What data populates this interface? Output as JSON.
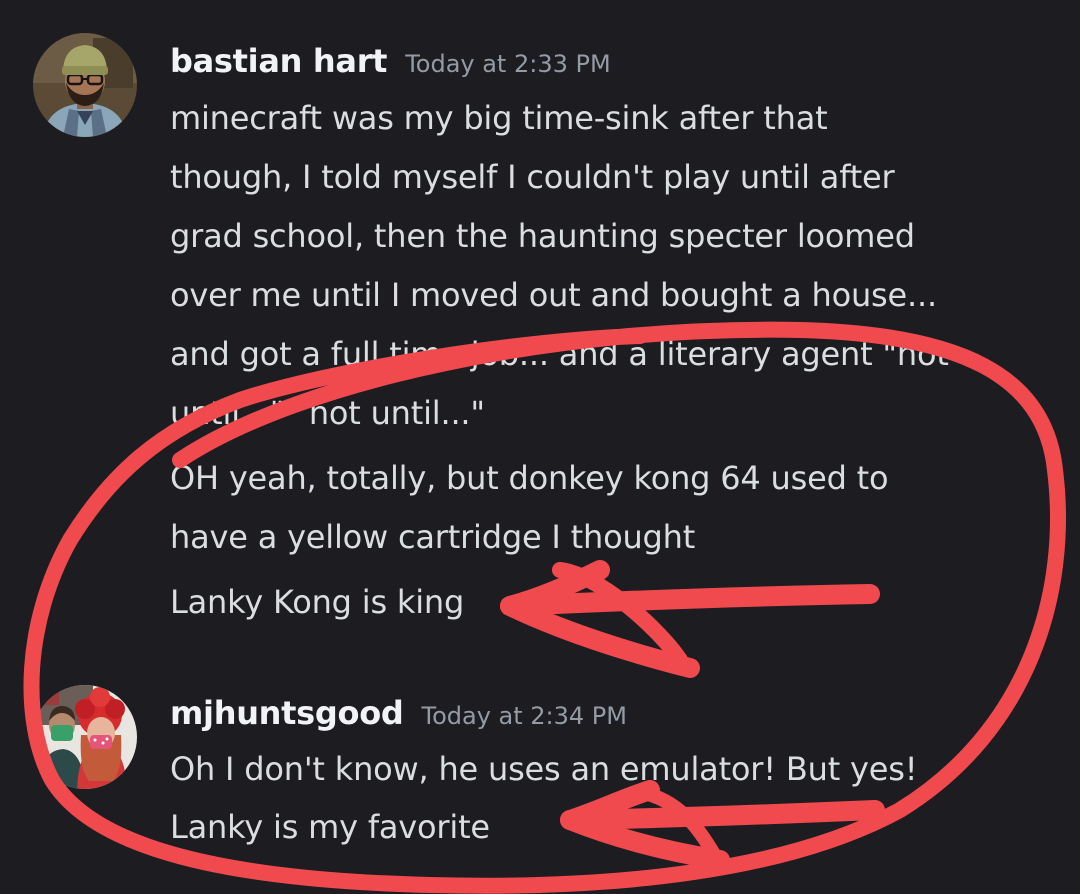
{
  "messages": [
    {
      "username": "bastian hart",
      "timestamp": "Today at 2:33 PM",
      "avatar_icon": "avatar-man-beanie-glasses",
      "lines": [
        "minecraft was my big time-sink after that",
        "though, I told myself I couldn't play until after",
        "grad school, then the haunting specter loomed",
        "over me until I moved out and bought a house...",
        "and got a full time job... and a literary agent \"not",
        "until...\" \"not until...\"",
        "OH yeah, totally, but donkey kong 64 used to",
        "have a yellow cartridge I thought",
        "Lanky Kong is king"
      ]
    },
    {
      "username": "mjhuntsgood",
      "timestamp": "Today at 2:34 PM",
      "avatar_icon": "avatar-couple-selfie",
      "lines": [
        "Oh I don't know, he uses an emulator! But yes!",
        "Lanky is my favorite"
      ]
    }
  ],
  "colors": {
    "background": "#1c1c21",
    "username": "#f2f3f5",
    "timestamp": "#949ba4",
    "message_text": "#dbdee1",
    "annotation_red": "#f04a4f"
  }
}
